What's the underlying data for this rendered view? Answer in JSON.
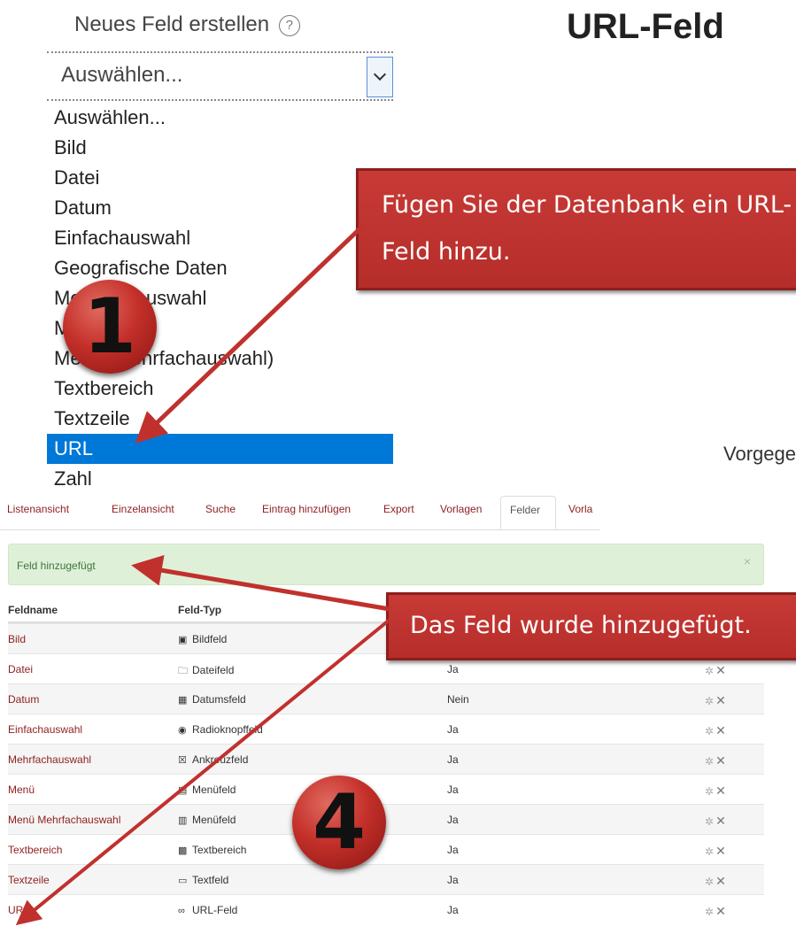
{
  "new_field": {
    "label": "Neues Feld erstellen",
    "help_glyph": "?",
    "selected": "Auswählen...",
    "options": [
      "Auswählen...",
      "Bild",
      "Datei",
      "Datum",
      "Einfachauswahl",
      "Geografische Daten",
      "Mehrfachauswahl",
      "Menü",
      "Menü (Mehrfachauswahl)",
      "Textbereich",
      "Textzeile",
      "URL",
      "Zahl"
    ],
    "highlighted_option": "URL"
  },
  "page_title": "URL-Feld",
  "default_label": "Vorgege",
  "callouts": {
    "step1": "Fügen Sie der Datenbank ein URL-Feld hinzu.",
    "step4": "Das Feld wurde hinzugefügt."
  },
  "badges": {
    "step1": "1",
    "step4": "4"
  },
  "tabs": [
    {
      "label": "Listenansicht",
      "active": false
    },
    {
      "label": "Einzelansicht",
      "active": false
    },
    {
      "label": "Suche",
      "active": false
    },
    {
      "label": "Eintrag hinzufügen",
      "active": false
    },
    {
      "label": "Export",
      "active": false
    },
    {
      "label": "Vorlagen",
      "active": false
    },
    {
      "label": "Felder",
      "active": true
    },
    {
      "label": "Vorla",
      "active": false
    }
  ],
  "alert": {
    "message": "Feld hinzugefügt",
    "close_glyph": "×"
  },
  "table": {
    "headers": {
      "name": "Feldname",
      "type": "Feld-Typ"
    },
    "rows": [
      {
        "name": "Bild",
        "icon": "image-icon",
        "type": "Bildfeld",
        "required": ""
      },
      {
        "name": "Datei",
        "icon": "folder-icon",
        "type": "Dateifeld",
        "required": "Ja"
      },
      {
        "name": "Datum",
        "icon": "calendar-icon",
        "type": "Datumsfeld",
        "required": "Nein"
      },
      {
        "name": "Einfachauswahl",
        "icon": "radio-icon",
        "type": "Radioknopffeld",
        "required": "Ja"
      },
      {
        "name": "Mehrfachauswahl",
        "icon": "checkbox-icon",
        "type": "Ankreuzfeld",
        "required": "Ja"
      },
      {
        "name": "Menü",
        "icon": "menu-icon",
        "type": "Menüfeld",
        "required": "Ja"
      },
      {
        "name": "Menü Mehrfachauswahl",
        "icon": "multimenu-icon",
        "type": "Menüfeld",
        "required": "Ja"
      },
      {
        "name": "Textbereich",
        "icon": "textarea-icon",
        "type": "Textbereich",
        "required": "Ja"
      },
      {
        "name": "Textzeile",
        "icon": "textfield-icon",
        "type": "Textfeld",
        "required": "Ja"
      },
      {
        "name": "URL",
        "icon": "link-icon",
        "type": "URL-Feld",
        "required": "Ja"
      }
    ]
  },
  "colors": {
    "accent": "#8f1e1e",
    "callout": "#c0312d",
    "selection": "#0078d7",
    "alert_bg": "#dff0d8"
  }
}
